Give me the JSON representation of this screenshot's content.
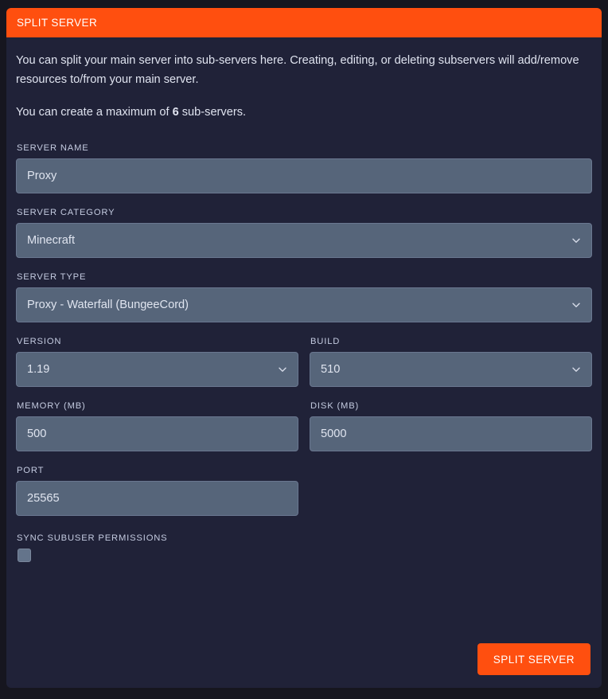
{
  "card": {
    "header_title": "SPLIT SERVER",
    "description_line_1": "You can split your main server into sub-servers here. Creating, editing, or deleting subservers will add/remove resources to/from your main server.",
    "description_line_2_prefix": "You can create a maximum of ",
    "max_subservers": "6",
    "description_line_2_suffix": " sub-servers."
  },
  "form": {
    "server_name": {
      "label": "SERVER NAME",
      "value": "Proxy",
      "placeholder": "Proxy"
    },
    "server_category": {
      "label": "SERVER CATEGORY",
      "value": "Minecraft",
      "options": [
        "Minecraft"
      ]
    },
    "server_type": {
      "label": "SERVER TYPE",
      "value": "Proxy - Waterfall (BungeeCord)",
      "options": [
        "Proxy - Waterfall (BungeeCord)"
      ]
    },
    "version": {
      "label": "VERSION",
      "value": "1.19",
      "options": [
        "1.19"
      ]
    },
    "build": {
      "label": "BUILD",
      "value": "510",
      "options": [
        "510"
      ]
    },
    "memory": {
      "label": "MEMORY (MB)",
      "value": "500",
      "placeholder": "500"
    },
    "disk": {
      "label": "DISK (MB)",
      "value": "5000",
      "placeholder": "5000"
    },
    "port": {
      "label": "PORT",
      "value": "25565",
      "placeholder": "25565"
    },
    "sync_subuser_permissions": {
      "label": "SYNC SUBUSER PERMISSIONS",
      "checked": false
    }
  },
  "actions": {
    "submit_label": "SPLIT SERVER"
  },
  "colors": {
    "accent": "#ff4f0f",
    "card_background": "#202238",
    "page_background": "#16161f",
    "input_background": "#56657a",
    "label_text": "#c4cbe0",
    "body_text": "#dfe3ef"
  },
  "icons": {
    "chevron_down": "chevron-down-icon"
  }
}
